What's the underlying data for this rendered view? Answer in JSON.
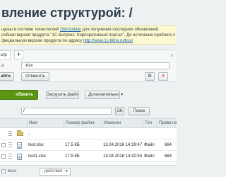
{
  "page": {
    "title": "вление структурой: /"
  },
  "notice": {
    "line1_pre": "щены в системе технологией ",
    "line1_link": "SiteUpdate",
    "line1_post": " для получения последних обновлений.",
    "line2": "робная версия продукта \"1С-Битрикс: Корпоративный портал\". До истечения пробного периода оста",
    "line3_pre": "фициальную версию продукта по адресу ",
    "line3_link": "http://www.1c-bitrix.ru/buy/"
  },
  "filter": {
    "tab_label": "ьтр",
    "add_tab": "+",
    "close": "×",
    "field_label": "а",
    "value": "xlsx",
    "find_label": "айти",
    "cancel_label": "Отменить",
    "settings_icon": "gear-icon",
    "close_icon": "close-icon"
  },
  "toolbar": {
    "create_label": "обавить",
    "upload_label": "Загрузить файл",
    "more_label": "Дополнительно"
  },
  "path": {
    "value": "/",
    "ok_label": "OK",
    "search_label": "Поиск"
  },
  "table": {
    "columns": [
      "Имя",
      "Размер файла",
      "Изменен",
      "Тип",
      "Права на доступ"
    ],
    "parent_row": "..",
    "rows": [
      {
        "name": "test.xlsx",
        "size": "17.5 КБ",
        "modified": "13.04.2016 14:39:47",
        "type": "Файл",
        "rights": "664"
      },
      {
        "name": "test1.xlsx",
        "size": "17.5 КБ",
        "modified": "13.04.2016 14:42:54",
        "type": "Файл",
        "rights": "664"
      }
    ]
  },
  "footer": {
    "select_all_label": "вcex",
    "action_select": "- действия -"
  },
  "colors": {
    "accent_green": "#5a9614",
    "notice_bg": "#fbf8d2",
    "link": "#2067b0"
  }
}
